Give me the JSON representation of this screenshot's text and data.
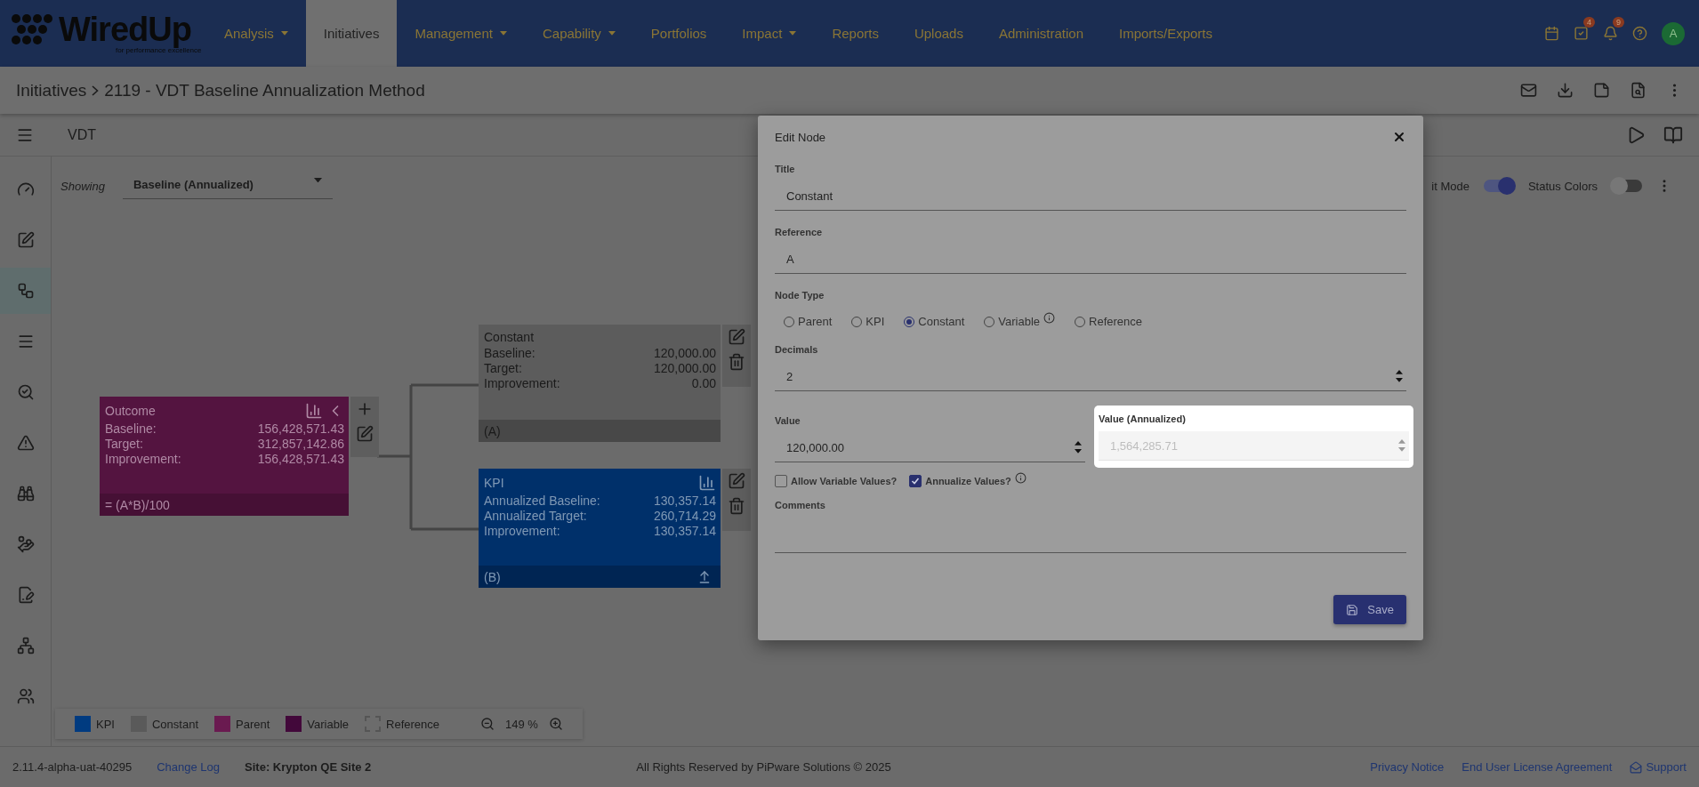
{
  "brand": {
    "name": "WiredUp",
    "tagline": "for performance excellence"
  },
  "nav": [
    {
      "label": "Analysis",
      "dropdown": true,
      "selected": false
    },
    {
      "label": "Initiatives",
      "dropdown": false,
      "selected": true
    },
    {
      "label": "Management",
      "dropdown": true,
      "selected": false
    },
    {
      "label": "Capability",
      "dropdown": true,
      "selected": false
    },
    {
      "label": "Portfolios",
      "dropdown": false,
      "selected": false
    },
    {
      "label": "Impact",
      "dropdown": true,
      "selected": false
    },
    {
      "label": "Reports",
      "dropdown": false,
      "selected": false
    },
    {
      "label": "Uploads",
      "dropdown": false,
      "selected": false
    },
    {
      "label": "Administration",
      "dropdown": false,
      "selected": false
    },
    {
      "label": "Imports/Exports",
      "dropdown": false,
      "selected": false
    }
  ],
  "header_icons": [
    {
      "kind": "calendar"
    },
    {
      "kind": "tasks",
      "badge": "4"
    },
    {
      "kind": "bell",
      "badge": "9"
    },
    {
      "kind": "help"
    }
  ],
  "avatar": "A",
  "breadcrumb": {
    "parent": "Initiatives",
    "current": "2119 - VDT Baseline Annualization Method"
  },
  "toolbar": {
    "title": "VDT"
  },
  "sidebar": [
    {
      "kind": "dashboard",
      "selected": false
    },
    {
      "kind": "edit",
      "selected": false
    },
    {
      "kind": "tree",
      "selected": true
    },
    {
      "kind": "list",
      "selected": false
    },
    {
      "kind": "search",
      "selected": false
    },
    {
      "kind": "risk",
      "selected": false
    },
    {
      "kind": "binoculars",
      "selected": false
    },
    {
      "kind": "benefit",
      "selected": false
    },
    {
      "kind": "sign",
      "selected": false
    },
    {
      "kind": "network",
      "selected": false
    },
    {
      "kind": "people",
      "selected": false
    }
  ],
  "showing": {
    "label": "Showing",
    "value": "Baseline (Annualized)"
  },
  "toggles": [
    {
      "label": "it Mode",
      "on": true
    },
    {
      "label": "Status Colors",
      "on": false
    }
  ],
  "nodes": [
    {
      "kind": "parent",
      "title": "Outcome",
      "rows": [
        {
          "label": "Baseline:",
          "value": "156,428,571.43"
        },
        {
          "label": "Target:",
          "value": "312,857,142.86"
        },
        {
          "label": "Improvement:",
          "value": "156,428,571.43"
        }
      ],
      "footer": "= (A*B)/100"
    },
    {
      "kind": "constant",
      "title": "Constant",
      "rows": [
        {
          "label": "Baseline:",
          "value": "120,000.00"
        },
        {
          "label": "Target:",
          "value": "120,000.00"
        },
        {
          "label": "Improvement:",
          "value": "0.00"
        }
      ],
      "footer": "(A)"
    },
    {
      "kind": "kpi",
      "title": "KPI",
      "rows": [
        {
          "label": "Annualized Baseline:",
          "value": "130,357.14"
        },
        {
          "label": "Annualized Target:",
          "value": "260,714.29"
        },
        {
          "label": "Improvement:",
          "value": "130,357.14"
        }
      ],
      "footer": "(B)"
    }
  ],
  "legend": [
    {
      "label": "KPI",
      "kind": "solid",
      "color": "#003b80"
    },
    {
      "label": "Constant",
      "kind": "solid",
      "color": "#5a5a5a"
    },
    {
      "label": "Parent",
      "kind": "solid",
      "color": "#6a1a50"
    },
    {
      "label": "Variable",
      "kind": "solid",
      "color": "#42083a"
    },
    {
      "label": "Reference",
      "kind": "dashed",
      "color": "#555555"
    }
  ],
  "zoom": "149 %",
  "dialog": {
    "title": "Edit Node",
    "title_field": {
      "label": "Title",
      "value": "Constant"
    },
    "reference_field": {
      "label": "Reference",
      "value": "A"
    },
    "node_type": {
      "label": "Node Type",
      "options": [
        {
          "label": "Parent",
          "selected": false,
          "info": false
        },
        {
          "label": "KPI",
          "selected": false,
          "info": false
        },
        {
          "label": "Constant",
          "selected": true,
          "info": false
        },
        {
          "label": "Variable",
          "selected": false,
          "info": true
        },
        {
          "label": "Reference",
          "selected": false,
          "info": false
        }
      ]
    },
    "decimals": {
      "label": "Decimals",
      "value": "2"
    },
    "value": {
      "label": "Value",
      "value": "120,000.00"
    },
    "annualized": {
      "label": "Value (Annualized)",
      "value": "1,564,285.71",
      "disabled": true
    },
    "checkboxes": [
      {
        "label": "Allow Variable Values?",
        "checked": false,
        "info": false
      },
      {
        "label": "Annualize Values?",
        "checked": true,
        "info": true
      }
    ],
    "comments": {
      "label": "Comments"
    },
    "save": "Save"
  },
  "footer": {
    "version": "2.11.4-alpha-uat-40295",
    "change_log": "Change Log",
    "site": "Site: Krypton QE Site 2",
    "copyright": "All Rights Reserved by PiPware Solutions © 2025",
    "links": [
      "Privacy Notice",
      "End User License Agreement"
    ],
    "support": "Support"
  }
}
